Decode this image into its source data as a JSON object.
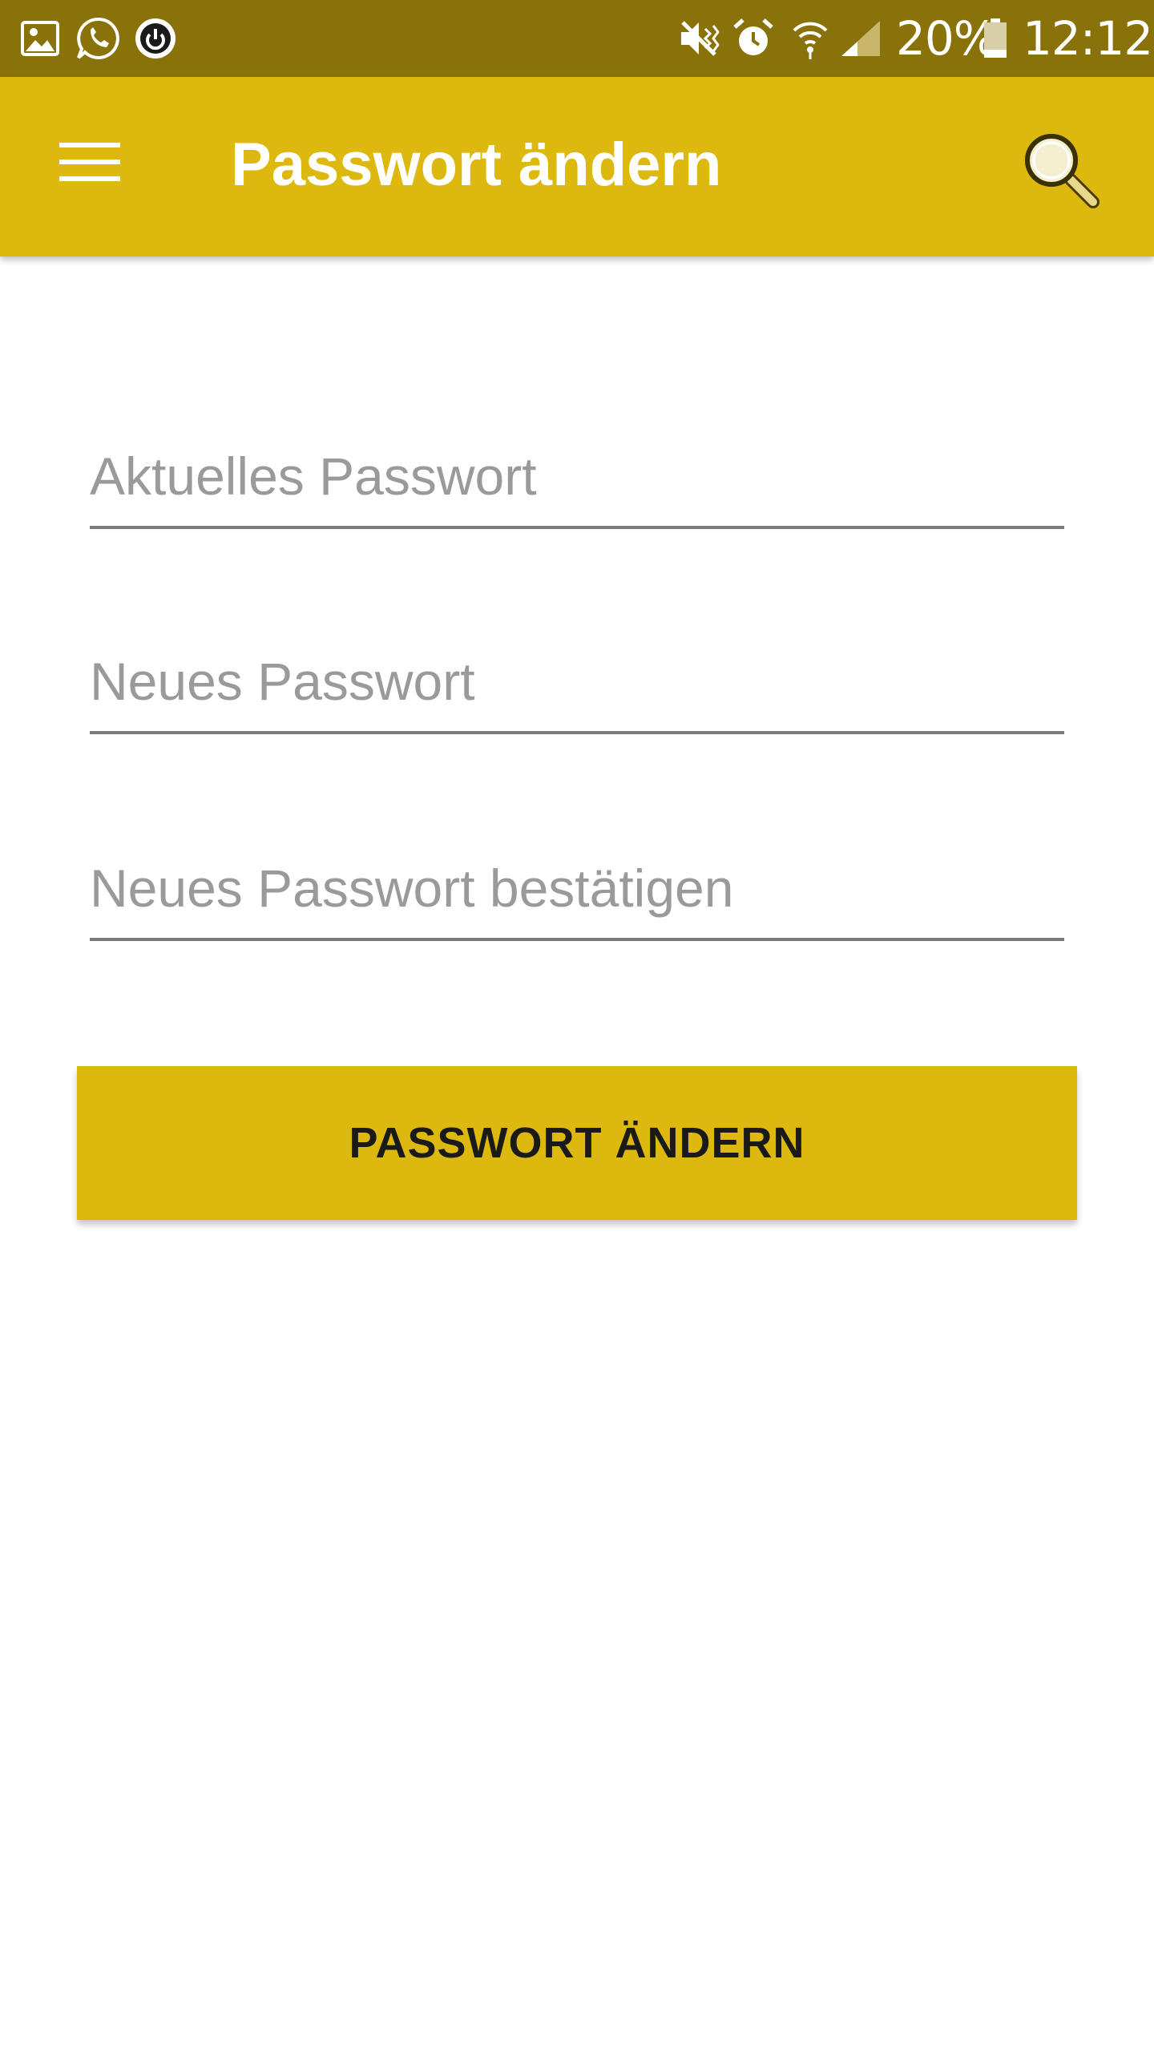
{
  "status_bar": {
    "left_icons": [
      "image-icon",
      "whatsapp-icon",
      "power-app-icon"
    ],
    "right_icons": [
      "vibrate-mute-icon",
      "alarm-icon",
      "wifi-icon",
      "signal-icon",
      "battery-icon"
    ],
    "battery_percent": "20%",
    "time": "12:12"
  },
  "app_bar": {
    "title": "Passwort ändern",
    "menu_icon": "hamburger-menu-icon",
    "search_icon": "search-icon",
    "background_color": "#DDB80E"
  },
  "form": {
    "current_password": {
      "placeholder": "Aktuelles Passwort",
      "value": ""
    },
    "new_password": {
      "placeholder": "Neues Passwort",
      "value": ""
    },
    "confirm_password": {
      "placeholder": "Neues Passwort bestätigen",
      "value": ""
    },
    "submit_label": "PASSWORT ÄNDERN"
  },
  "colors": {
    "status_bar": "#89720A",
    "accent": "#DDB80E"
  }
}
